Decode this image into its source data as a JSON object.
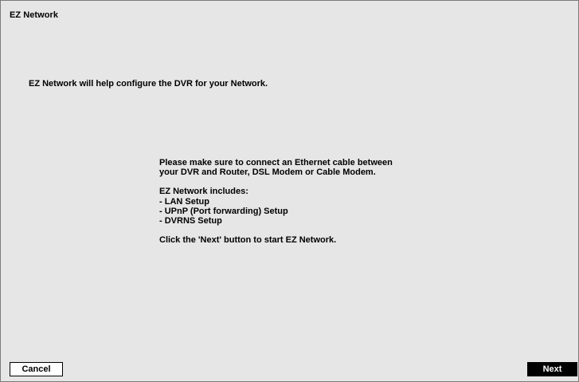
{
  "window": {
    "title": "EZ Network"
  },
  "intro": {
    "text": "EZ Network will help configure the DVR for your Network."
  },
  "info": {
    "connect_line1": "Please make sure to connect an Ethernet cable between",
    "connect_line2": "your DVR and Router, DSL Modem or Cable Modem.",
    "includes_heading": "EZ Network includes:",
    "includes_items": [
      "- LAN Setup",
      "- UPnP (Port forwarding) Setup",
      "- DVRNS Setup"
    ],
    "instruction": "Click the 'Next' button to start EZ Network."
  },
  "buttons": {
    "cancel_label": "Cancel",
    "next_label": "Next"
  },
  "colors": {
    "panel_background": "#e6e6e6",
    "next_button_background": "#000000",
    "cancel_button_background": "#ffffff"
  }
}
